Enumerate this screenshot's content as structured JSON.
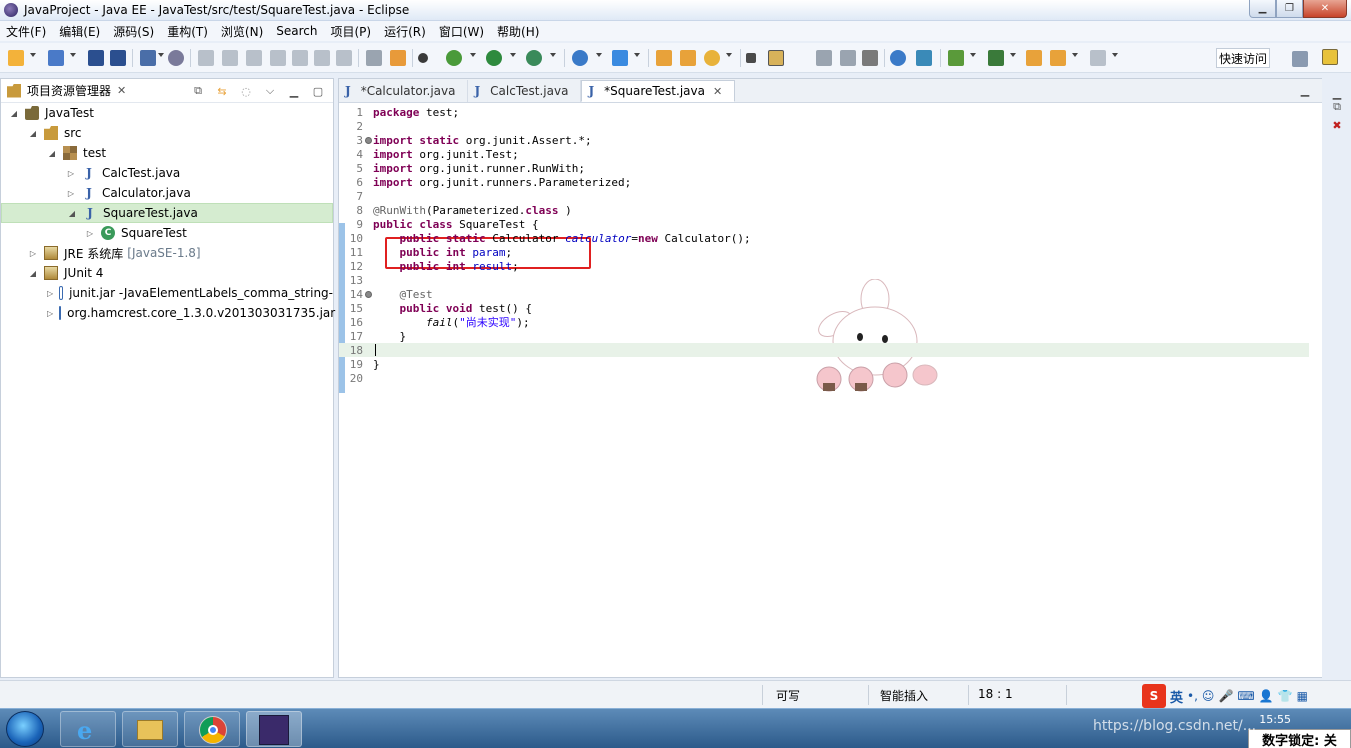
{
  "window": {
    "title": "JavaProject - Java EE - JavaTest/src/test/SquareTest.java - Eclipse"
  },
  "menu": [
    "文件(F)",
    "编辑(E)",
    "源码(S)",
    "重构(T)",
    "浏览(N)",
    "Search",
    "项目(P)",
    "运行(R)",
    "窗口(W)",
    "帮助(H)"
  ],
  "toolbar": {
    "quick_access": "快速访问"
  },
  "explorer": {
    "title": "项目资源管理器",
    "tree": [
      {
        "label": "JavaTest",
        "icon": "project-icon",
        "level": 0,
        "twisty": "expanded"
      },
      {
        "label": "src",
        "icon": "source-folder-icon",
        "level": 1,
        "twisty": "expanded"
      },
      {
        "label": "test",
        "icon": "package-icon",
        "level": 2,
        "twisty": "expanded"
      },
      {
        "label": "CalcTest.java",
        "icon": "java-file-icon",
        "level": 3,
        "twisty": "collapsed"
      },
      {
        "label": "Calculator.java",
        "icon": "java-file-icon",
        "level": 3,
        "twisty": "collapsed"
      },
      {
        "label": "SquareTest.java",
        "icon": "java-file-icon",
        "level": 3,
        "twisty": "expanded",
        "selected": true
      },
      {
        "label": "SquareTest",
        "icon": "class-icon",
        "level": 4,
        "twisty": "collapsed"
      },
      {
        "label": "JRE 系统库",
        "decor": "[JavaSE-1.8]",
        "icon": "library-icon",
        "level": 1,
        "twisty": "collapsed"
      },
      {
        "label": "JUnit 4",
        "icon": "library-icon",
        "level": 1,
        "twisty": "expanded"
      },
      {
        "label": "junit.jar -JavaElementLabels_comma_string-",
        "icon": "jar-icon",
        "level": 2,
        "twisty": "collapsed"
      },
      {
        "label": "org.hamcrest.core_1.3.0.v201303031735.jar",
        "icon": "jar-icon",
        "level": 2,
        "twisty": "collapsed"
      }
    ]
  },
  "editor": {
    "tabs": [
      {
        "label": "*Calculator.java",
        "active": false
      },
      {
        "label": "CalcTest.java",
        "active": false
      },
      {
        "label": "*SquareTest.java",
        "active": true
      }
    ],
    "lines": [
      {
        "n": "1",
        "parts": [
          [
            "kw",
            "package"
          ],
          [
            "",
            "test;"
          ]
        ]
      },
      {
        "n": "2",
        "parts": []
      },
      {
        "n": "3",
        "fold": true,
        "parts": [
          [
            "kw",
            "import"
          ],
          [
            "",
            ""
          ],
          [
            "kw",
            "static"
          ],
          [
            "",
            "org.junit.Assert.*;"
          ]
        ]
      },
      {
        "n": "4",
        "parts": [
          [
            "kw",
            "import"
          ],
          [
            "",
            "org.junit.Test;"
          ]
        ]
      },
      {
        "n": "5",
        "parts": [
          [
            "kw",
            "import"
          ],
          [
            "",
            "org.junit.runner.RunWith;"
          ]
        ]
      },
      {
        "n": "6",
        "parts": [
          [
            "kw",
            "import"
          ],
          [
            "",
            "org.junit.runners.Parameterized;"
          ]
        ]
      },
      {
        "n": "7",
        "parts": []
      },
      {
        "n": "8",
        "parts": [
          [
            "ann",
            "@RunWith"
          ],
          [
            "",
            "(Parameterized."
          ],
          [
            "kw",
            "class"
          ],
          [
            "",
            ")"
          ]
        ]
      },
      {
        "n": "9",
        "parts": [
          [
            "kw",
            "public"
          ],
          [
            "",
            ""
          ],
          [
            "kw",
            "class"
          ],
          [
            "",
            "SquareTest {"
          ]
        ]
      },
      {
        "n": "10",
        "parts": [
          [
            "",
            "    "
          ],
          [
            "kw",
            "public"
          ],
          [
            "",
            ""
          ],
          [
            "kw",
            "static"
          ],
          [
            "",
            "Calculator "
          ],
          [
            "ifld",
            "calculator"
          ],
          [
            "",
            "="
          ],
          [
            "kw",
            "new"
          ],
          [
            "",
            "Calculator();"
          ]
        ]
      },
      {
        "n": "11",
        "parts": [
          [
            "",
            "    "
          ],
          [
            "kw",
            "public"
          ],
          [
            "",
            ""
          ],
          [
            "kw",
            "int"
          ],
          [
            "",
            ""
          ],
          [
            "fld",
            "param"
          ],
          [
            "",
            ";"
          ]
        ]
      },
      {
        "n": "12",
        "parts": [
          [
            "",
            "    "
          ],
          [
            "kw",
            "public"
          ],
          [
            "",
            ""
          ],
          [
            "kw",
            "int"
          ],
          [
            "",
            ""
          ],
          [
            "fld",
            "result"
          ],
          [
            "",
            ";"
          ]
        ]
      },
      {
        "n": "13",
        "parts": []
      },
      {
        "n": "14",
        "fold": true,
        "parts": [
          [
            "",
            "    "
          ],
          [
            "ann",
            "@Test"
          ]
        ]
      },
      {
        "n": "15",
        "parts": [
          [
            "",
            "    "
          ],
          [
            "kw",
            "public"
          ],
          [
            "",
            ""
          ],
          [
            "kw",
            "void"
          ],
          [
            "",
            "test() {"
          ]
        ]
      },
      {
        "n": "16",
        "parts": [
          [
            "",
            "        "
          ],
          [
            "ital",
            "fail"
          ],
          [
            "",
            "("
          ],
          [
            "str",
            "\"尚未实现\""
          ],
          [
            "",
            ");"
          ]
        ]
      },
      {
        "n": "17",
        "parts": [
          [
            "",
            "    }"
          ]
        ]
      },
      {
        "n": "18",
        "current": true,
        "parts": []
      },
      {
        "n": "19",
        "parts": [
          [
            "",
            "}"
          ]
        ]
      },
      {
        "n": "20",
        "parts": []
      }
    ]
  },
  "status": {
    "writable": "可写",
    "insert_mode": "智能插入",
    "position": "18 : 1"
  },
  "ime": {
    "lang": "英"
  },
  "taskbar": {
    "clock": "15:55",
    "numlock": "数字锁定: 关",
    "watermark": "https://blog.csdn.net/..."
  }
}
